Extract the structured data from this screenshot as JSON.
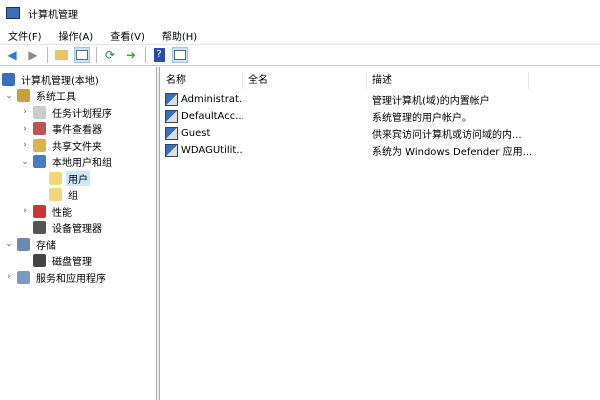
{
  "window": {
    "title": "计算机管理"
  },
  "menu": [
    "文件(F)",
    "操作(A)",
    "查看(V)",
    "帮助(H)"
  ],
  "toolbar": [
    "back-icon",
    "forward-icon",
    "up-folder-icon",
    "show-hide-tree-icon",
    "refresh-icon",
    "export-icon",
    "help-icon",
    "show-action-pane-icon"
  ],
  "tree": [
    {
      "label": "计算机管理(本地)",
      "level": 0,
      "expander": "",
      "icon": "computer-management-icon"
    },
    {
      "label": "系统工具",
      "level": 0,
      "expander": "open",
      "icon": "system-tools-icon"
    },
    {
      "label": "任务计划程序",
      "level": 1,
      "expander": "closed",
      "icon": "clock-icon"
    },
    {
      "label": "事件查看器",
      "level": 1,
      "expander": "closed",
      "icon": "event-viewer-icon"
    },
    {
      "label": "共享文件夹",
      "level": 1,
      "expander": "closed",
      "icon": "shared-folder-icon"
    },
    {
      "label": "本地用户和组",
      "level": 1,
      "expander": "open",
      "icon": "users-group-icon"
    },
    {
      "label": "用户",
      "level": 2,
      "expander": "",
      "icon": "folder-icon",
      "selected": true
    },
    {
      "label": "组",
      "level": 2,
      "expander": "",
      "icon": "folder-icon"
    },
    {
      "label": "性能",
      "level": 1,
      "expander": "closed",
      "icon": "performance-icon"
    },
    {
      "label": "设备管理器",
      "level": 1,
      "expander": "",
      "icon": "device-manager-icon"
    },
    {
      "label": "存储",
      "level": 0,
      "expander": "open",
      "icon": "storage-icon"
    },
    {
      "label": "磁盘管理",
      "level": 1,
      "expander": "",
      "icon": "disk-icon"
    },
    {
      "label": "服务和应用程序",
      "level": 0,
      "expander": "closed",
      "icon": "services-icon"
    }
  ],
  "list": {
    "columns": [
      "名称",
      "全名",
      "描述"
    ],
    "rows": [
      {
        "name": "Administrat...",
        "fullname": "",
        "desc": "管理计算机(域)的内置帐户"
      },
      {
        "name": "DefaultAcc...",
        "fullname": "",
        "desc": "系统管理的用户帐户。"
      },
      {
        "name": "Guest",
        "fullname": "",
        "desc": "供来宾访问计算机或访问域的内..."
      },
      {
        "name": "WDAGUtilit...",
        "fullname": "",
        "desc": "系统为 Windows Defender 应用..."
      }
    ]
  }
}
